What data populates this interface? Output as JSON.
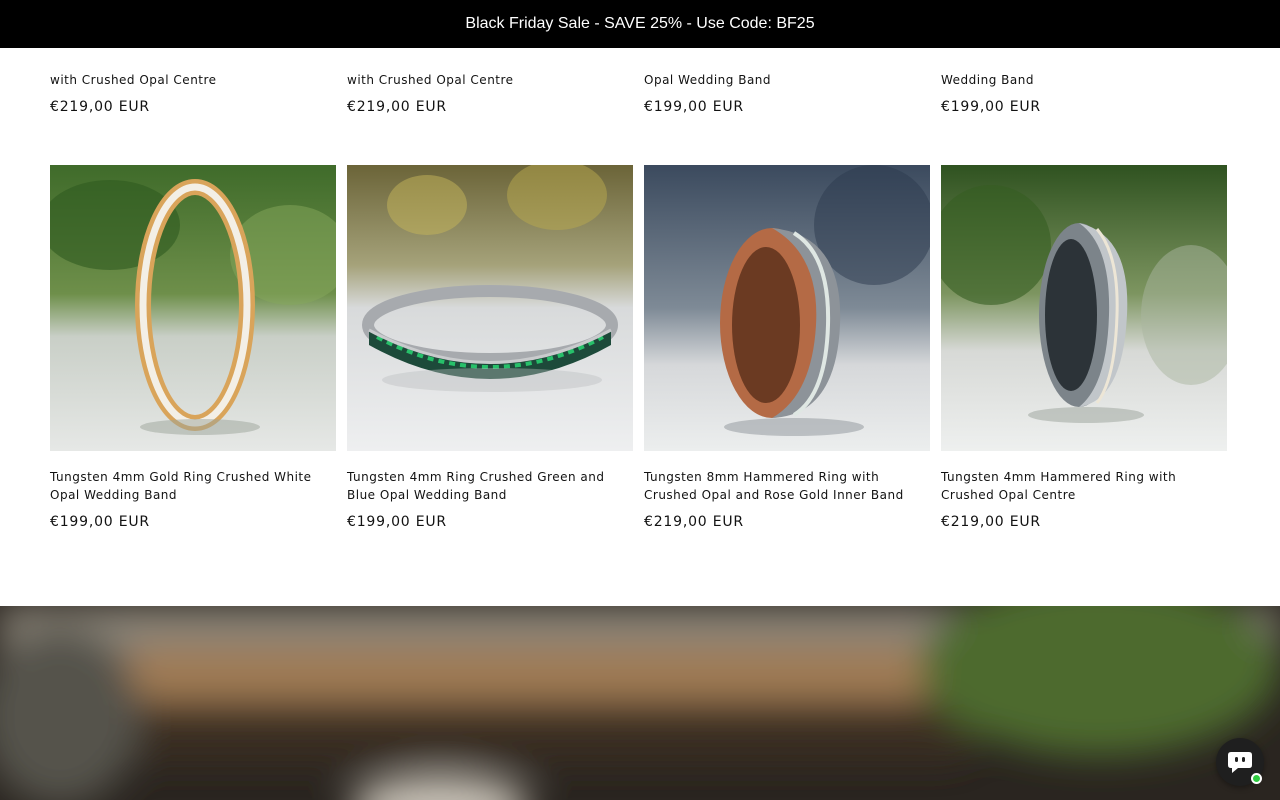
{
  "announcement": {
    "text": "Black Friday Sale - SAVE 25% - Use Code: BF25"
  },
  "previous_row": [
    {
      "title_tail": "with Crushed Opal Centre",
      "price": "€219,00 EUR"
    },
    {
      "title_tail": "with Crushed Opal Centre",
      "price": "€219,00 EUR"
    },
    {
      "title_tail": "Opal Wedding Band",
      "price": "€199,00 EUR"
    },
    {
      "title_tail": "Wedding Band",
      "price": "€199,00 EUR"
    }
  ],
  "products": [
    {
      "title": "Tungsten 4mm Gold Ring Crushed White Opal Wedding Band",
      "price": "€199,00 EUR",
      "image": "gold-white-opal-ring"
    },
    {
      "title": "Tungsten 4mm Ring Crushed Green and Blue Opal Wedding Band",
      "price": "€199,00 EUR",
      "image": "green-blue-opal-ring"
    },
    {
      "title": "Tungsten 8mm Hammered Ring with Crushed Opal and Rose Gold Inner Band",
      "price": "€219,00 EUR",
      "image": "hammered-rose-gold-ring"
    },
    {
      "title": "Tungsten 4mm Hammered Ring with Crushed Opal Centre",
      "price": "€219,00 EUR",
      "image": "hammered-opal-ring"
    }
  ],
  "chat": {
    "icon": "chat-bubble-icon",
    "status": "online"
  },
  "colors": {
    "announcement_bg": "#000000",
    "text": "#121212",
    "online": "#2ecc40"
  }
}
